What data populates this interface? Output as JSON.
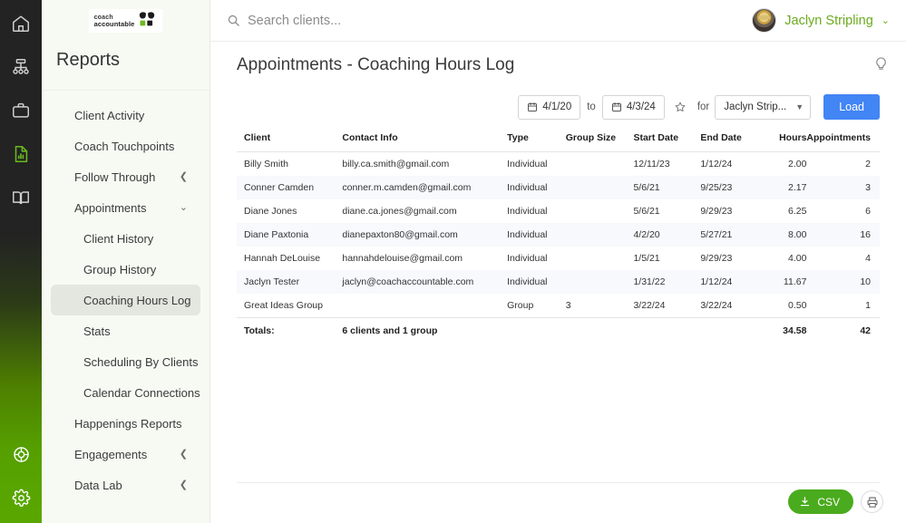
{
  "rail": {
    "top_icons": [
      {
        "name": "home-icon",
        "active": false
      },
      {
        "name": "org-chart-icon",
        "active": false
      },
      {
        "name": "briefcase-icon",
        "active": false
      },
      {
        "name": "report-document-icon",
        "active": true
      },
      {
        "name": "book-icon",
        "active": false
      }
    ],
    "bottom_icons": [
      {
        "name": "lifebuoy-help-icon"
      },
      {
        "name": "gear-settings-icon"
      }
    ],
    "active_color": "#6aba1e"
  },
  "sidebar": {
    "logo": {
      "line1": "coach",
      "line2": "accountable"
    },
    "title": "Reports",
    "items": [
      {
        "label": "Client Activity",
        "sub": false,
        "chevron": "",
        "active": false
      },
      {
        "label": "Coach Touchpoints",
        "sub": false,
        "chevron": "",
        "active": false
      },
      {
        "label": "Follow Through",
        "sub": false,
        "chevron": "left",
        "active": false
      },
      {
        "label": "Appointments",
        "sub": false,
        "chevron": "down",
        "active": false
      },
      {
        "label": "Client History",
        "sub": true,
        "chevron": "",
        "active": false
      },
      {
        "label": "Group History",
        "sub": true,
        "chevron": "",
        "active": false
      },
      {
        "label": "Coaching Hours Log",
        "sub": true,
        "chevron": "",
        "active": true
      },
      {
        "label": "Stats",
        "sub": true,
        "chevron": "",
        "active": false
      },
      {
        "label": "Scheduling By Clients",
        "sub": true,
        "chevron": "",
        "active": false
      },
      {
        "label": "Calendar Connections",
        "sub": true,
        "chevron": "",
        "active": false
      },
      {
        "label": "Happenings Reports",
        "sub": false,
        "chevron": "",
        "active": false
      },
      {
        "label": "Engagements",
        "sub": false,
        "chevron": "left",
        "active": false
      },
      {
        "label": "Data Lab",
        "sub": false,
        "chevron": "left",
        "active": false
      }
    ]
  },
  "topbar": {
    "search_placeholder": "Search clients...",
    "search_value": "",
    "user_name": "Jaclyn Stripling",
    "user_caret": "⌄",
    "user_name_color": "#6aaa1e"
  },
  "page": {
    "title": "Appointments - Coaching Hours Log",
    "bulb_tooltip": "lightbulb"
  },
  "filters": {
    "start_date": "4/1/20",
    "to_label": "to",
    "end_date": "4/3/24",
    "for_label": "for",
    "coach_selected": "Jaclyn Strip...",
    "load_label": "Load",
    "load_color": "#4285f4"
  },
  "table": {
    "columns": [
      {
        "key": "client",
        "label": "Client",
        "align": "left"
      },
      {
        "key": "contact",
        "label": "Contact Info",
        "align": "left"
      },
      {
        "key": "type",
        "label": "Type",
        "align": "left"
      },
      {
        "key": "group_size",
        "label": "Group Size",
        "align": "left"
      },
      {
        "key": "start_date",
        "label": "Start Date",
        "align": "left"
      },
      {
        "key": "end_date",
        "label": "End Date",
        "align": "left"
      },
      {
        "key": "hours",
        "label": "Hours",
        "align": "right"
      },
      {
        "key": "appointments",
        "label": "Appointments",
        "align": "right"
      }
    ],
    "rows": [
      {
        "client": "Billy Smith",
        "contact": "billy.ca.smith@gmail.com",
        "type": "Individual",
        "group_size": "",
        "start_date": "12/11/23",
        "end_date": "1/12/24",
        "hours": "2.00",
        "appointments": "2"
      },
      {
        "client": "Conner Camden",
        "contact": "conner.m.camden@gmail.com",
        "type": "Individual",
        "group_size": "",
        "start_date": "5/6/21",
        "end_date": "9/25/23",
        "hours": "2.17",
        "appointments": "3"
      },
      {
        "client": "Diane Jones",
        "contact": "diane.ca.jones@gmail.com",
        "type": "Individual",
        "group_size": "",
        "start_date": "5/6/21",
        "end_date": "9/29/23",
        "hours": "6.25",
        "appointments": "6"
      },
      {
        "client": "Diane Paxtonia",
        "contact": "dianepaxton80@gmail.com",
        "type": "Individual",
        "group_size": "",
        "start_date": "4/2/20",
        "end_date": "5/27/21",
        "hours": "8.00",
        "appointments": "16"
      },
      {
        "client": "Hannah DeLouise",
        "contact": "hannahdelouise@gmail.com",
        "type": "Individual",
        "group_size": "",
        "start_date": "1/5/21",
        "end_date": "9/29/23",
        "hours": "4.00",
        "appointments": "4"
      },
      {
        "client": "Jaclyn Tester",
        "contact": "jaclyn@coachaccountable.com",
        "type": "Individual",
        "group_size": "",
        "start_date": "1/31/22",
        "end_date": "1/12/24",
        "hours": "11.67",
        "appointments": "10"
      },
      {
        "client": "Great Ideas Group",
        "contact": "",
        "type": "Group",
        "group_size": "3",
        "start_date": "3/22/24",
        "end_date": "3/22/24",
        "hours": "0.50",
        "appointments": "1"
      }
    ],
    "totals": {
      "label": "Totals:",
      "summary": "6 clients and 1 group",
      "type": "",
      "group_size": "",
      "start_date": "",
      "end_date": "",
      "hours": "34.58",
      "appointments": "42"
    }
  },
  "actions": {
    "csv_label": "CSV",
    "csv_color": "#4aab1e",
    "print_name": "printer"
  }
}
